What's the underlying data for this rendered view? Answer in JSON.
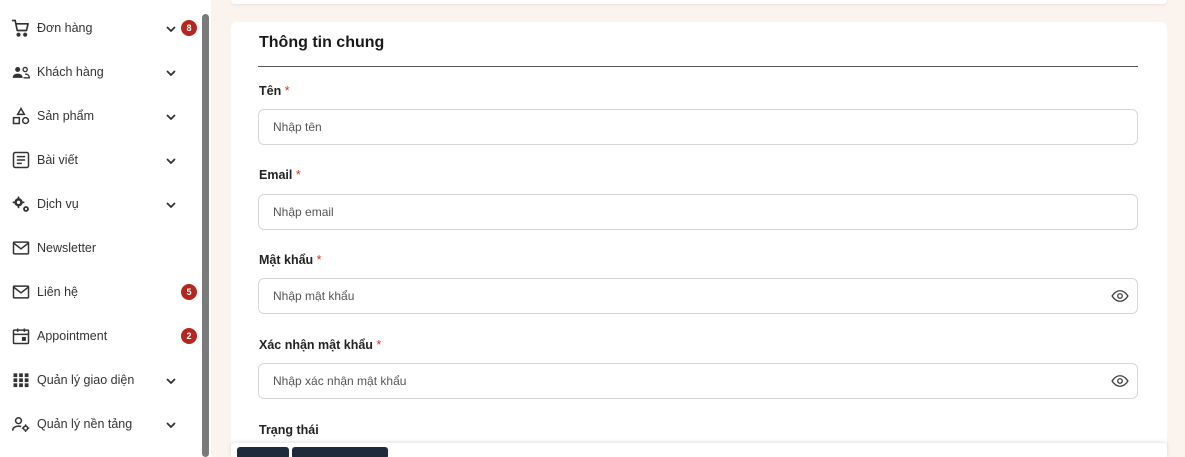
{
  "sidebar": {
    "items": [
      {
        "label": "Đơn hàng",
        "icon": "cart-icon",
        "has_chevron": true,
        "badge": "8"
      },
      {
        "label": "Khách hàng",
        "icon": "users-icon",
        "has_chevron": true
      },
      {
        "label": "Sản phẩm",
        "icon": "shapes-icon",
        "has_chevron": true
      },
      {
        "label": "Bài viết",
        "icon": "article-icon",
        "has_chevron": true
      },
      {
        "label": "Dịch vụ",
        "icon": "gears-icon",
        "has_chevron": true
      },
      {
        "label": "Newsletter",
        "icon": "mail-icon",
        "has_chevron": false
      },
      {
        "label": "Liên hệ",
        "icon": "mail-icon",
        "has_chevron": false,
        "badge": "5"
      },
      {
        "label": "Appointment",
        "icon": "calendar-icon",
        "has_chevron": false,
        "badge": "2"
      },
      {
        "label": "Quản lý giao diện",
        "icon": "grid-icon",
        "has_chevron": true
      },
      {
        "label": "Quản lý nền tảng",
        "icon": "user-cog-icon",
        "has_chevron": true
      }
    ]
  },
  "form": {
    "title": "Thông tin chung",
    "fields": {
      "name": {
        "label": "Tên",
        "required_mark": "*",
        "placeholder": "Nhập tên",
        "value": ""
      },
      "email": {
        "label": "Email",
        "required_mark": "*",
        "placeholder": "Nhập email",
        "value": ""
      },
      "password": {
        "label": "Mật khẩu",
        "required_mark": "*",
        "placeholder": "Nhập mật khẩu",
        "value": ""
      },
      "confirm_password": {
        "label": "Xác nhận mật khẩu",
        "required_mark": "*",
        "placeholder": "Nhập xác nhận mật khẩu",
        "value": ""
      },
      "status": {
        "label": "Trạng thái"
      }
    }
  },
  "colors": {
    "badge": "#b52620",
    "required": "#d9342b",
    "page_bg": "#fbf3ee",
    "button_dark": "#1f2b3a"
  }
}
